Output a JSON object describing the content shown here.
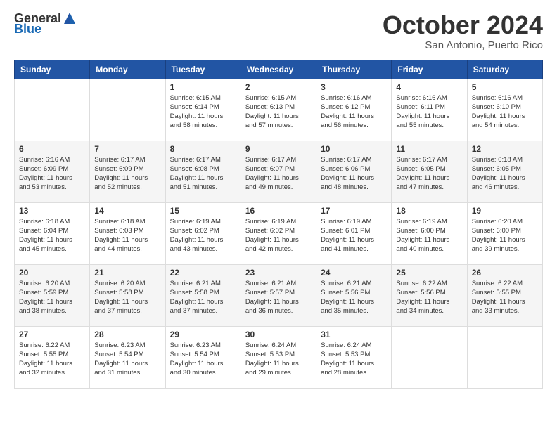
{
  "logo": {
    "general": "General",
    "blue": "Blue"
  },
  "header": {
    "month": "October 2024",
    "location": "San Antonio, Puerto Rico"
  },
  "weekdays": [
    "Sunday",
    "Monday",
    "Tuesday",
    "Wednesday",
    "Thursday",
    "Friday",
    "Saturday"
  ],
  "weeks": [
    [
      {
        "day": "",
        "info": ""
      },
      {
        "day": "",
        "info": ""
      },
      {
        "day": "1",
        "info": "Sunrise: 6:15 AM\nSunset: 6:14 PM\nDaylight: 11 hours and 58 minutes."
      },
      {
        "day": "2",
        "info": "Sunrise: 6:15 AM\nSunset: 6:13 PM\nDaylight: 11 hours and 57 minutes."
      },
      {
        "day": "3",
        "info": "Sunrise: 6:16 AM\nSunset: 6:12 PM\nDaylight: 11 hours and 56 minutes."
      },
      {
        "day": "4",
        "info": "Sunrise: 6:16 AM\nSunset: 6:11 PM\nDaylight: 11 hours and 55 minutes."
      },
      {
        "day": "5",
        "info": "Sunrise: 6:16 AM\nSunset: 6:10 PM\nDaylight: 11 hours and 54 minutes."
      }
    ],
    [
      {
        "day": "6",
        "info": "Sunrise: 6:16 AM\nSunset: 6:09 PM\nDaylight: 11 hours and 53 minutes."
      },
      {
        "day": "7",
        "info": "Sunrise: 6:17 AM\nSunset: 6:09 PM\nDaylight: 11 hours and 52 minutes."
      },
      {
        "day": "8",
        "info": "Sunrise: 6:17 AM\nSunset: 6:08 PM\nDaylight: 11 hours and 51 minutes."
      },
      {
        "day": "9",
        "info": "Sunrise: 6:17 AM\nSunset: 6:07 PM\nDaylight: 11 hours and 49 minutes."
      },
      {
        "day": "10",
        "info": "Sunrise: 6:17 AM\nSunset: 6:06 PM\nDaylight: 11 hours and 48 minutes."
      },
      {
        "day": "11",
        "info": "Sunrise: 6:17 AM\nSunset: 6:05 PM\nDaylight: 11 hours and 47 minutes."
      },
      {
        "day": "12",
        "info": "Sunrise: 6:18 AM\nSunset: 6:05 PM\nDaylight: 11 hours and 46 minutes."
      }
    ],
    [
      {
        "day": "13",
        "info": "Sunrise: 6:18 AM\nSunset: 6:04 PM\nDaylight: 11 hours and 45 minutes."
      },
      {
        "day": "14",
        "info": "Sunrise: 6:18 AM\nSunset: 6:03 PM\nDaylight: 11 hours and 44 minutes."
      },
      {
        "day": "15",
        "info": "Sunrise: 6:19 AM\nSunset: 6:02 PM\nDaylight: 11 hours and 43 minutes."
      },
      {
        "day": "16",
        "info": "Sunrise: 6:19 AM\nSunset: 6:02 PM\nDaylight: 11 hours and 42 minutes."
      },
      {
        "day": "17",
        "info": "Sunrise: 6:19 AM\nSunset: 6:01 PM\nDaylight: 11 hours and 41 minutes."
      },
      {
        "day": "18",
        "info": "Sunrise: 6:19 AM\nSunset: 6:00 PM\nDaylight: 11 hours and 40 minutes."
      },
      {
        "day": "19",
        "info": "Sunrise: 6:20 AM\nSunset: 6:00 PM\nDaylight: 11 hours and 39 minutes."
      }
    ],
    [
      {
        "day": "20",
        "info": "Sunrise: 6:20 AM\nSunset: 5:59 PM\nDaylight: 11 hours and 38 minutes."
      },
      {
        "day": "21",
        "info": "Sunrise: 6:20 AM\nSunset: 5:58 PM\nDaylight: 11 hours and 37 minutes."
      },
      {
        "day": "22",
        "info": "Sunrise: 6:21 AM\nSunset: 5:58 PM\nDaylight: 11 hours and 37 minutes."
      },
      {
        "day": "23",
        "info": "Sunrise: 6:21 AM\nSunset: 5:57 PM\nDaylight: 11 hours and 36 minutes."
      },
      {
        "day": "24",
        "info": "Sunrise: 6:21 AM\nSunset: 5:56 PM\nDaylight: 11 hours and 35 minutes."
      },
      {
        "day": "25",
        "info": "Sunrise: 6:22 AM\nSunset: 5:56 PM\nDaylight: 11 hours and 34 minutes."
      },
      {
        "day": "26",
        "info": "Sunrise: 6:22 AM\nSunset: 5:55 PM\nDaylight: 11 hours and 33 minutes."
      }
    ],
    [
      {
        "day": "27",
        "info": "Sunrise: 6:22 AM\nSunset: 5:55 PM\nDaylight: 11 hours and 32 minutes."
      },
      {
        "day": "28",
        "info": "Sunrise: 6:23 AM\nSunset: 5:54 PM\nDaylight: 11 hours and 31 minutes."
      },
      {
        "day": "29",
        "info": "Sunrise: 6:23 AM\nSunset: 5:54 PM\nDaylight: 11 hours and 30 minutes."
      },
      {
        "day": "30",
        "info": "Sunrise: 6:24 AM\nSunset: 5:53 PM\nDaylight: 11 hours and 29 minutes."
      },
      {
        "day": "31",
        "info": "Sunrise: 6:24 AM\nSunset: 5:53 PM\nDaylight: 11 hours and 28 minutes."
      },
      {
        "day": "",
        "info": ""
      },
      {
        "day": "",
        "info": ""
      }
    ]
  ]
}
